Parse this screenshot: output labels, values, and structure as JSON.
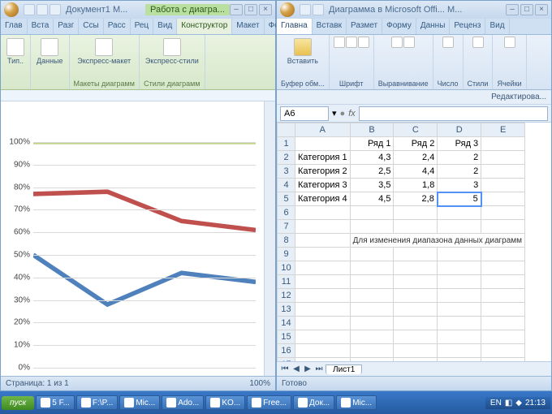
{
  "word": {
    "title": "Документ1 M...",
    "context_tab": "Работа с диагра...",
    "tabs": [
      "Глав",
      "Вста",
      "Разг",
      "Ссы",
      "Расс",
      "Рец",
      "Вид",
      "Конструктор",
      "Макет",
      "Формат"
    ],
    "ribbon": {
      "btn_type": "Тип..",
      "btn_data": "Данные",
      "btn_layouts": "Экспресс-макет",
      "btn_styles": "Экспресс-стили",
      "grp_layouts": "Макеты диаграмм",
      "grp_styles": "Стили диаграмм"
    },
    "status_page": "Страница: 1 из 1",
    "status_zoom": "100%"
  },
  "excel": {
    "title": "Диаграмма в Microsoft Offi... M...",
    "tabs": [
      "Главна",
      "Вставк",
      "Размет",
      "Форму",
      "Данны",
      "Реценз",
      "Вид"
    ],
    "ribbon": {
      "paste": "Вставить",
      "clipboard": "Буфер обм...",
      "font": "Шрифт",
      "align": "Выравнивание",
      "number": "Число",
      "styles": "Стили",
      "cells": "Ячейки",
      "editing": "Редактирова..."
    },
    "namebox": "A6",
    "columns": [
      "A",
      "B",
      "C",
      "D",
      "E"
    ],
    "headers": [
      "",
      "Ряд 1",
      "Ряд 2",
      "Ряд 3"
    ],
    "rows": [
      [
        "Категория 1",
        "4,3",
        "2,4",
        "2"
      ],
      [
        "Категория 2",
        "2,5",
        "4,4",
        "2"
      ],
      [
        "Категория 3",
        "3,5",
        "1,8",
        "3"
      ],
      [
        "Категория 4",
        "4,5",
        "2,8",
        "5"
      ]
    ],
    "note": "Для изменения диапазона данных диаграмм",
    "sheet_name": "Лист1",
    "status": "Готово"
  },
  "chart_data": {
    "type": "line",
    "categories": [
      "Категория 1",
      "Категория 2",
      "Категория 3",
      "Категория 4"
    ],
    "series": [
      {
        "name": "Ряд 1 (100%)",
        "values": [
          100,
          100,
          100,
          100
        ],
        "color": "#c2d48a"
      },
      {
        "name": "Ряд 2 (red)",
        "values": [
          77,
          78,
          65,
          61
        ],
        "color": "#c0504d"
      },
      {
        "name": "Ряд 3 (blue)",
        "values": [
          50,
          28,
          42,
          38
        ],
        "color": "#4f81bd"
      }
    ],
    "ylim": [
      0,
      100
    ],
    "yticks": [
      0,
      10,
      20,
      30,
      40,
      50,
      60,
      70,
      80,
      90,
      100
    ]
  },
  "taskbar": {
    "start": "пуск",
    "items": [
      "5 F...",
      "F:\\P...",
      "Mic...",
      "Ado...",
      "KO...",
      "Free...",
      "Док...",
      "Mic..."
    ],
    "lang": "EN",
    "clock": "21:13"
  }
}
